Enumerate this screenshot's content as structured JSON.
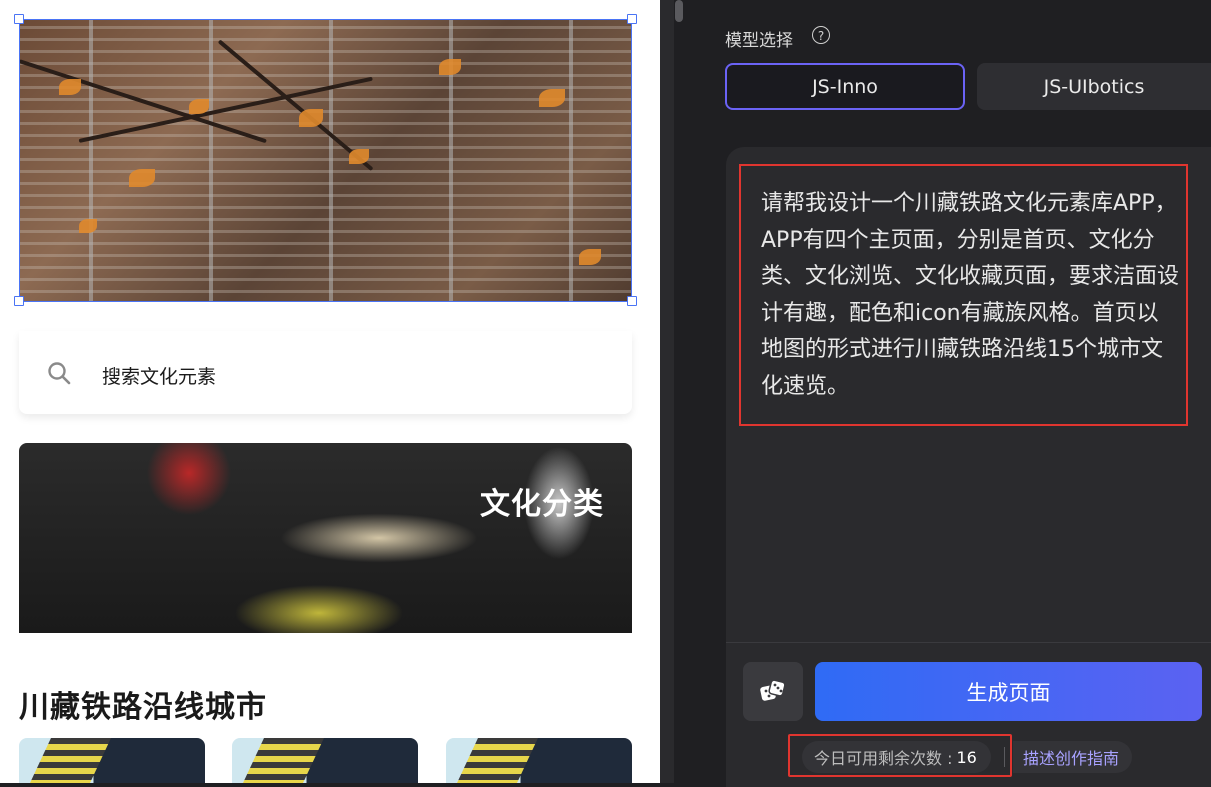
{
  "canvas": {
    "search_placeholder": "搜索文化元素",
    "culture_banner_label": "文化分类",
    "section_title": "川藏铁路沿线城市"
  },
  "panel": {
    "model_label": "模型选择",
    "models": [
      {
        "label": "JS-Inno",
        "selected": true
      },
      {
        "label": "JS-UIbotics",
        "selected": false
      }
    ],
    "prompt_text": "请帮我设计一个川藏铁路文化元素库APP，APP有四个主页面，分别是首页、文化分类、文化浏览、文化收藏页面，要求洁面设计有趣，配色和icon有藏族风格。首页以地图的形式进行川藏铁路沿线15个城市文化速览。",
    "generate_label": "生成页面",
    "quota_label": "今日可用剩余次数 :",
    "quota_value": "16",
    "guide_label": "描述创作指南"
  },
  "colors": {
    "accent": "#6b63f5",
    "generate_gradient_start": "#2f6bf5",
    "generate_gradient_end": "#5b62f2",
    "highlight_red": "#e0352f",
    "selection_blue": "#4a74f5"
  },
  "icons": [
    "search-icon",
    "help-icon",
    "dice-icon"
  ]
}
